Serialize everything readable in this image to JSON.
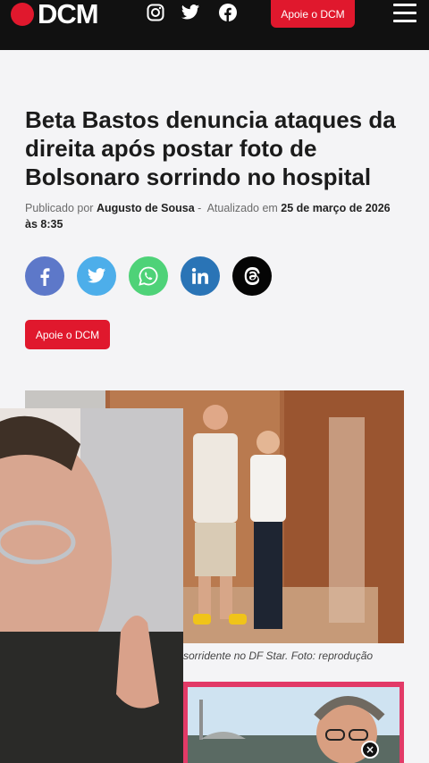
{
  "header": {
    "logo_text": "DCM",
    "support_button": "Apoie o DCM",
    "social": [
      "instagram-icon",
      "twitter-icon",
      "facebook-icon"
    ]
  },
  "article": {
    "title": "Beta Bastos denuncia ataques da direita após postar foto de Bolsonaro sorrindo no hospital",
    "published_label": "Publicado por",
    "author": "Augusto de Sousa",
    "separator": "-",
    "updated_label": "Atualizado em",
    "updated_date": "25 de março de 2026",
    "updated_time": "às 8:35",
    "support_button": "Apoie o DCM",
    "caption": "sorridente no DF Star. Foto: reprodução",
    "close_symbol": "×"
  },
  "share": [
    {
      "name": "facebook",
      "color": "#3b5998"
    },
    {
      "name": "twitter",
      "color": "#1da1f2"
    },
    {
      "name": "whatsapp",
      "color": "#25d366"
    },
    {
      "name": "linkedin",
      "color": "#0077b5"
    },
    {
      "name": "threads",
      "color": "#000000"
    }
  ],
  "colors": {
    "brand_red": "#e0182d",
    "header_bg": "#111111",
    "background": "#f4f4f6"
  }
}
